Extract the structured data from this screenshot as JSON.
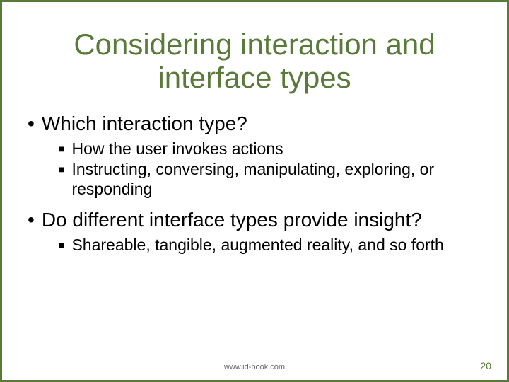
{
  "title": "Considering interaction and interface types",
  "bullets": [
    {
      "text": "Which interaction type?",
      "sub": [
        "How the user invokes actions",
        "Instructing, conversing, manipulating, exploring, or responding"
      ]
    },
    {
      "text": "Do different interface types provide insight?",
      "sub": [
        "Shareable, tangible, augmented reality, and so forth"
      ]
    }
  ],
  "footer": {
    "url": "www.id-book.com",
    "page": "20"
  }
}
